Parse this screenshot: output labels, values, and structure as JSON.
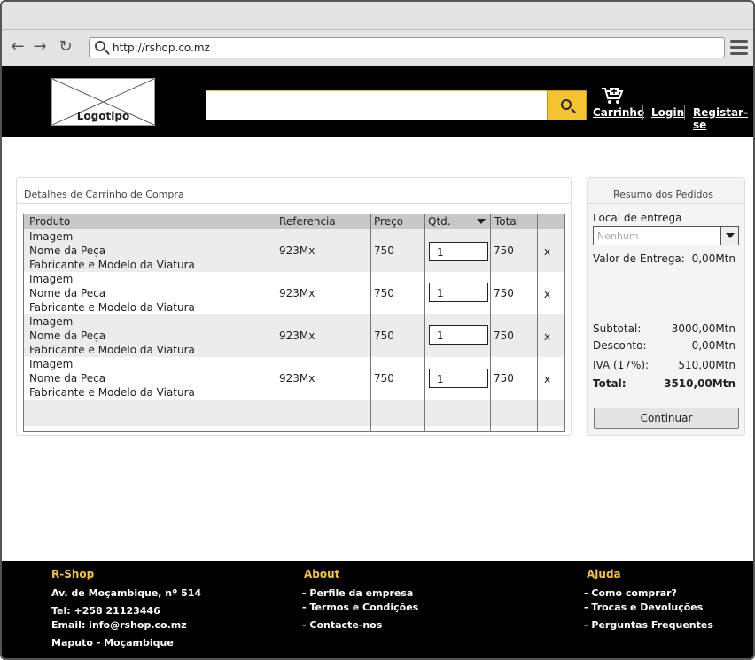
{
  "browser": {
    "url": "http://rshop.co.mz"
  },
  "header": {
    "logo_text": "Logotipo",
    "search_value": "",
    "cart_label": "Carrinho",
    "login_label": "Login",
    "register_label": "Registar-se"
  },
  "cart": {
    "title": "Detalhes de Carrinho de Compra",
    "columns": [
      "Produto",
      "Referencia",
      "Preço",
      "Qtd.",
      "Total",
      ""
    ],
    "rows": [
      {
        "line1": "Imagem",
        "line2": "Nome da Peça",
        "line3": "Fabricante e Modelo da Viatura",
        "ref": "923Mx",
        "price": "750",
        "qty": "1",
        "total": "750",
        "remove": "x"
      },
      {
        "line1": "Imagem",
        "line2": "Nome da Peça",
        "line3": "Fabricante e Modelo da Viatura",
        "ref": "923Mx",
        "price": "750",
        "qty": "1",
        "total": "750",
        "remove": "x"
      },
      {
        "line1": "Imagem",
        "line2": "Nome da Peça",
        "line3": "Fabricante e Modelo da Viatura",
        "ref": "923Mx",
        "price": "750",
        "qty": "1",
        "total": "750",
        "remove": "x"
      },
      {
        "line1": "Imagem",
        "line2": "Nome da Peça",
        "line3": "Fabricante e Modelo da Viatura",
        "ref": "923Mx",
        "price": "750",
        "qty": "1",
        "total": "750",
        "remove": "x"
      }
    ]
  },
  "summary": {
    "title": "Resumo dos Pedidos",
    "delivery_location_label": "Local de entrega",
    "delivery_location_placeholder": "Nenhum",
    "delivery_value_label": "Valor de Entrega:",
    "delivery_value": "0,00Mtn",
    "subtotal_label": "Subtotal:",
    "subtotal": "3000,00Mtn",
    "discount_label": "Desconto:",
    "discount": "0,00Mtn",
    "vat_label": "IVA (17%):",
    "vat": "510,00Mtn",
    "total_label": "Total:",
    "total": "3510,00Mtn",
    "continue_label": "Continuar"
  },
  "footer": {
    "col1": {
      "title": "R-Shop",
      "items": [
        "Av. de Moçambique, nº 514",
        "Tel: +258 21123446",
        "Email: info@rshop.co.mz",
        "Maputo - Moçambique"
      ]
    },
    "col2": {
      "title": "About",
      "items": [
        "- Perfile da empresa",
        "- Termos e Condições",
        "- Contacte-nos"
      ]
    },
    "col3": {
      "title": "Ajuda",
      "items": [
        "- Como comprar?",
        "- Trocas e Devoluções",
        "- Perguntas Frequentes"
      ]
    }
  },
  "colors": {
    "accent": "#f4c430",
    "header_bg": "#000000",
    "chrome_bg": "#e4e4e4"
  }
}
